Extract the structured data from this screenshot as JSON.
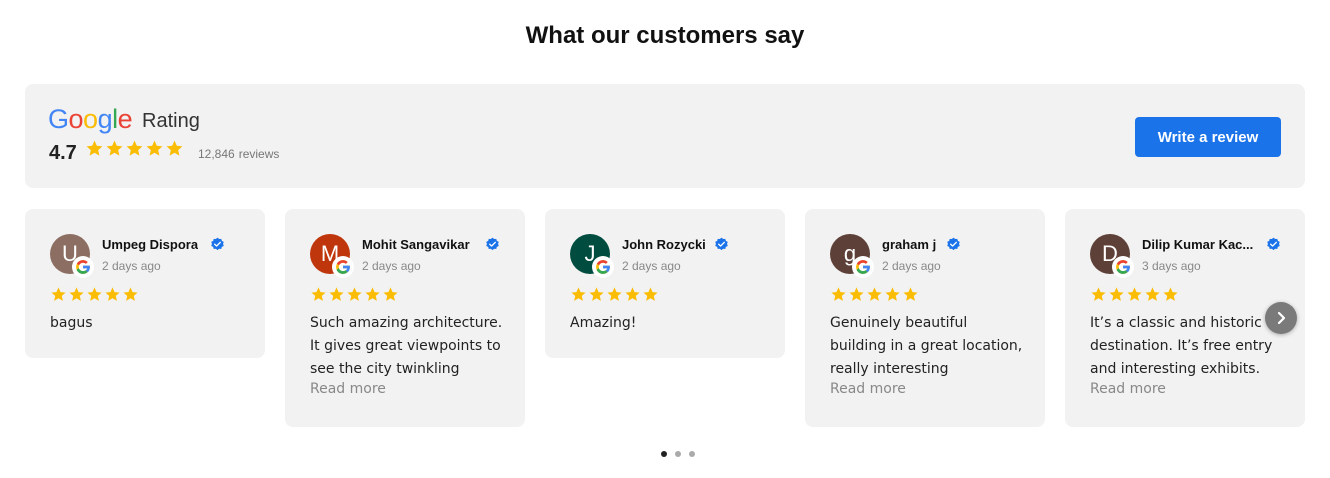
{
  "section": {
    "title": "What our customers say"
  },
  "summary": {
    "logo_letters": [
      "G",
      "o",
      "o",
      "g",
      "l",
      "e"
    ],
    "rating_label": "Rating",
    "average": "4.7",
    "stars": 5,
    "review_count": "12,846",
    "reviews_word": "reviews",
    "write_review_label": "Write a review"
  },
  "reviews": [
    {
      "initial": "U",
      "name": "Umpeg Dispora",
      "date": "2 days ago",
      "stars": 5,
      "text": "bagus",
      "read_more": "",
      "avatar_color": "#8d6e63"
    },
    {
      "initial": "M",
      "name": "Mohit Sangavikar",
      "date": "2 days ago",
      "stars": 5,
      "text": "Such amazing architecture. It gives great viewpoints to see the city twinkling",
      "read_more": "Read more",
      "avatar_color": "#bf360c"
    },
    {
      "initial": "J",
      "name": "John Rozycki",
      "date": "2 days ago",
      "stars": 5,
      "text": "Amazing!",
      "read_more": "",
      "avatar_color": "#004d40"
    },
    {
      "initial": "g",
      "name": "graham j",
      "date": "2 days ago",
      "stars": 5,
      "text": "Genuinely beautiful building in a great location, really interesting",
      "read_more": "Read more",
      "avatar_color": "#5d4037"
    },
    {
      "initial": "D",
      "name": "Dilip Kumar Kac...",
      "date": "3 days ago",
      "stars": 5,
      "text": "It’s a classic and historic destination. It’s free entry and interesting exhibits.",
      "read_more": "Read more",
      "avatar_color": "#5d4037"
    }
  ],
  "pagination": {
    "pages": 3,
    "active": 0
  },
  "colors": {
    "accent": "#1a73e8",
    "star": "#fbbc04",
    "verified": "#1a73e8",
    "card_bg": "#f2f2f2",
    "google_blue": "#4285f4",
    "google_red": "#ea4335",
    "google_yellow": "#fbbc05",
    "google_green": "#34a853"
  },
  "icons": {
    "star": "star-icon",
    "verified": "verified-badge-icon",
    "google": "google-g-icon",
    "next": "chevron-right-icon"
  }
}
